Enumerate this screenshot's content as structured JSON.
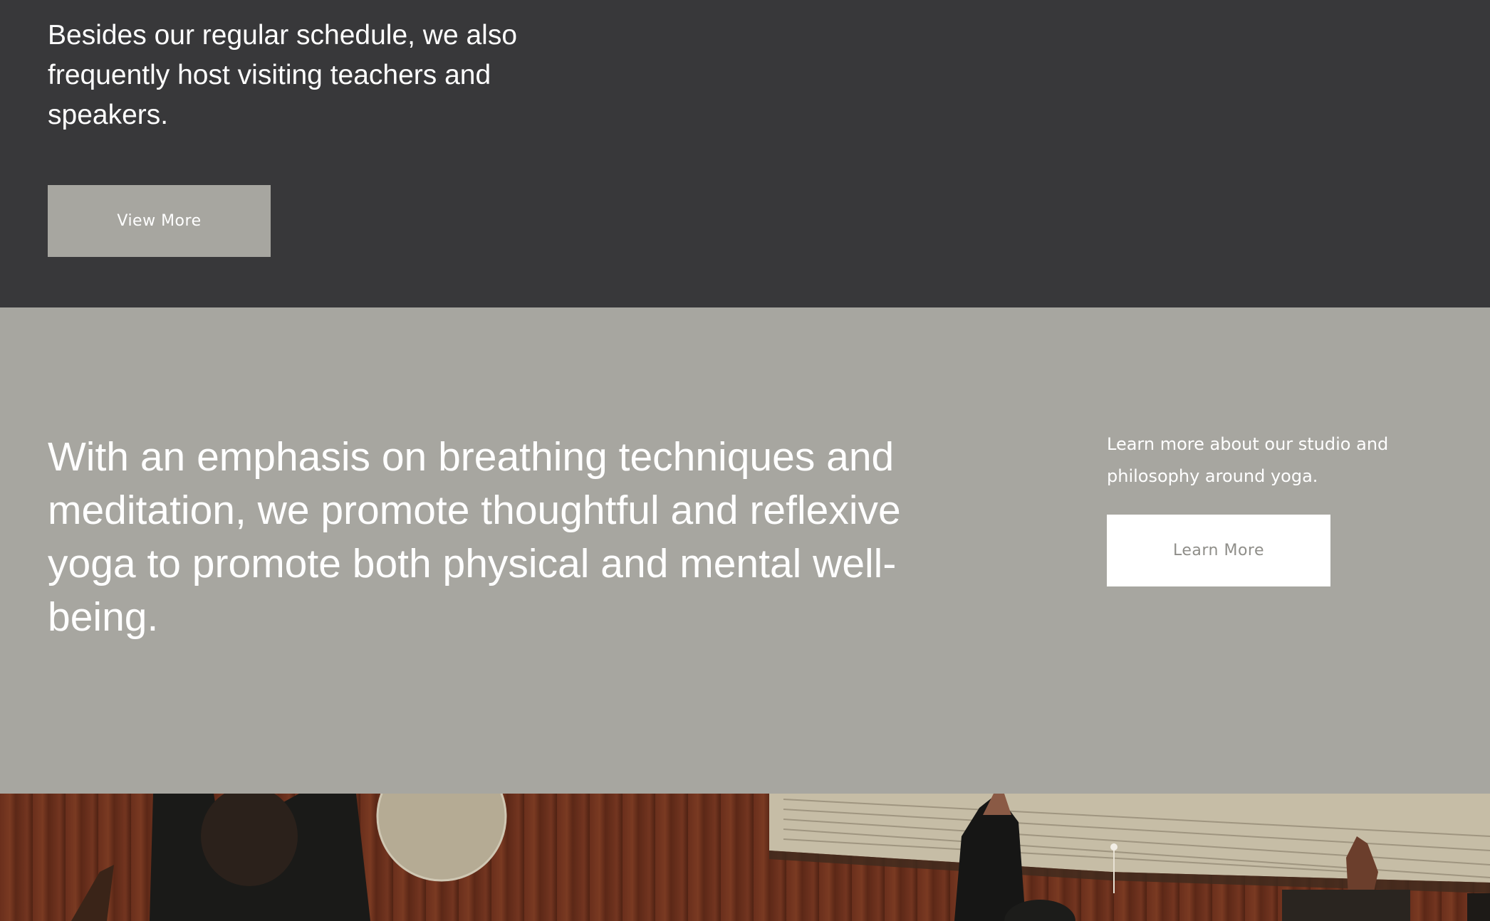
{
  "visiting_section": {
    "text": "Besides our regular schedule, we also frequently host visiting teachers and speakers.",
    "button_label": "View More"
  },
  "philosophy_section": {
    "headline": "With an emphasis on breathing techniques and meditation, we promote thoughtful and reflexive yoga to promote both physical and mental well-being.",
    "side_text": "Learn more about our studio and philosophy around yoga.",
    "button_label": "Learn More"
  },
  "colors": {
    "dark_background": "#38383a",
    "grey_background": "#a7a6a0",
    "button_background_light": "#ffffff",
    "button_text_muted": "#8f8e89"
  },
  "photo": {
    "subject": "yoga-class-photo"
  }
}
